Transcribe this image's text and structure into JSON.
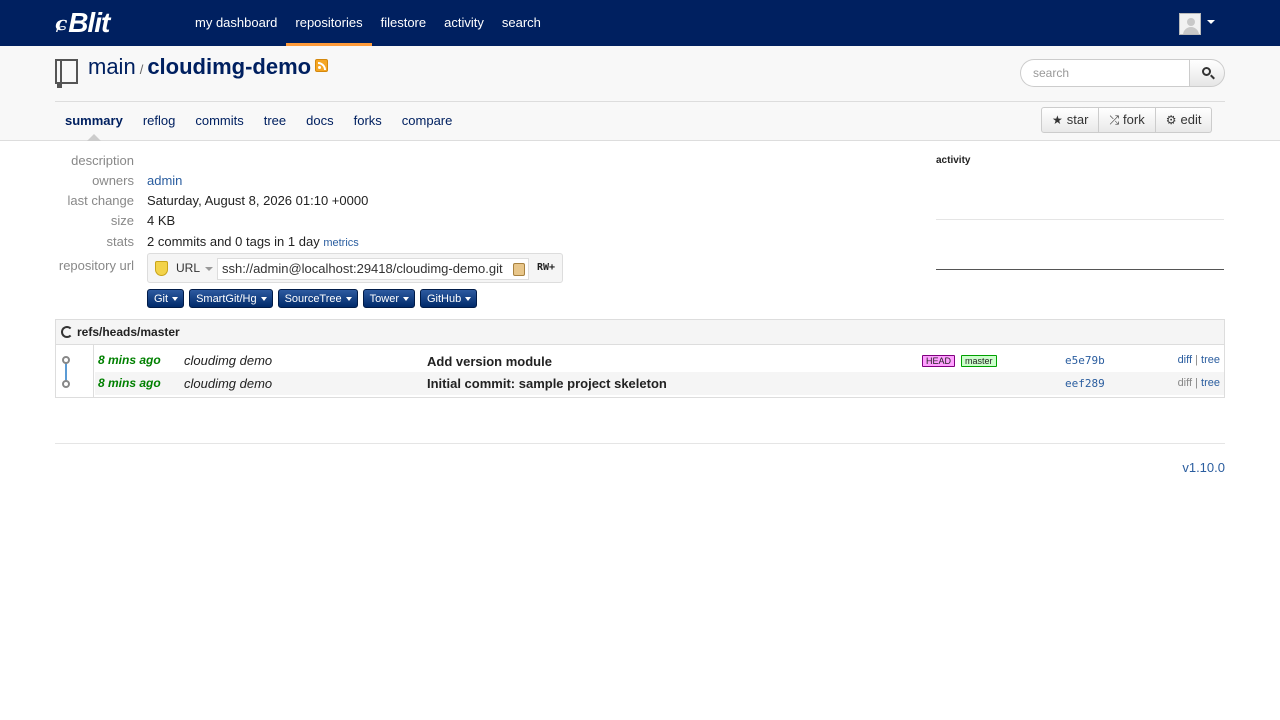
{
  "app": {
    "logo_mark": "ɕ",
    "logo_word": "Blit"
  },
  "nav": {
    "items": [
      {
        "label": "my dashboard"
      },
      {
        "label": "repositories"
      },
      {
        "label": "filestore"
      },
      {
        "label": "activity"
      },
      {
        "label": "search"
      }
    ],
    "active": "repositories"
  },
  "repo": {
    "project": "main",
    "separator": "/",
    "name": "cloudimg-demo"
  },
  "search": {
    "placeholder": "search"
  },
  "tabs": {
    "items": [
      {
        "label": "summary"
      },
      {
        "label": "reflog"
      },
      {
        "label": "commits"
      },
      {
        "label": "tree"
      },
      {
        "label": "docs"
      },
      {
        "label": "forks"
      },
      {
        "label": "compare"
      }
    ],
    "active": "summary"
  },
  "actions": {
    "star": "star",
    "fork": "fork",
    "edit": "edit"
  },
  "summary": {
    "labels": {
      "description": "description",
      "owners": "owners",
      "last_change": "last change",
      "size": "size",
      "stats": "stats",
      "repository_url": "repository url"
    },
    "owners": "admin",
    "last_change": "Saturday, August 8, 2026 01:10 +0000",
    "size": "4 KB",
    "stats": "2 commits and 0 tags in 1 day",
    "metrics": "metrics",
    "url_type": "URL",
    "url": "ssh://admin@localhost:29418/cloudimg-demo.git",
    "permission": "RW+"
  },
  "clients": [
    {
      "label": "Git"
    },
    {
      "label": "SmartGit/Hg"
    },
    {
      "label": "SourceTree"
    },
    {
      "label": "Tower"
    },
    {
      "label": "GitHub"
    }
  ],
  "activity": {
    "label": "activity"
  },
  "log": {
    "ref": "refs/heads/master",
    "commits": [
      {
        "age": "8 mins ago",
        "author": "cloudimg demo",
        "message": "Add version module",
        "head": "HEAD",
        "branch": "master",
        "sha": "e5e79b",
        "diff": "diff",
        "sep": "|",
        "tree": "tree"
      },
      {
        "age": "8 mins ago",
        "author": "cloudimg demo",
        "message": "Initial commit: sample project skeleton",
        "sha": "eef289",
        "diff": "diff",
        "sep": "|",
        "tree": "tree"
      }
    ]
  },
  "footer": {
    "version": "v1.10.0"
  },
  "colors": {
    "topbar": "#002060",
    "active_tab_underline": "#ff9b3a",
    "age_green": "#008000",
    "link_blue": "#2a5d9f"
  }
}
